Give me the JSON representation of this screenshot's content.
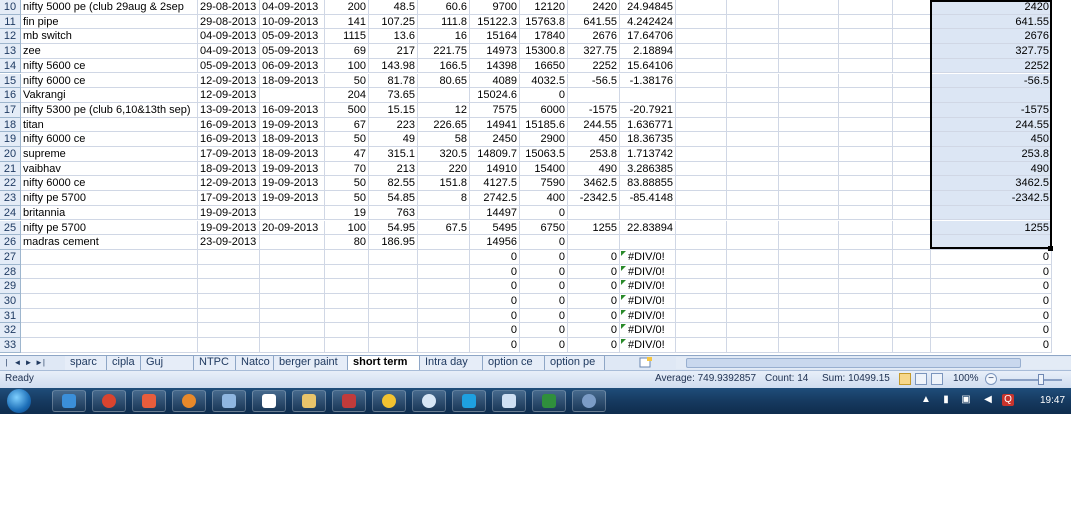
{
  "rows": [
    {
      "n": "10",
      "cells": [
        "nifty 5000 pe (club 29aug & 2sep",
        "29-08-2013",
        "04-09-2013",
        "200",
        "48.5",
        "60.6",
        "9700",
        "12120",
        "2420",
        "24.94845"
      ],
      "sel": "2420"
    },
    {
      "n": "11",
      "cells": [
        "fin pipe",
        "29-08-2013",
        "10-09-2013",
        "141",
        "107.25",
        "111.8",
        "15122.3",
        "15763.8",
        "641.55",
        "4.242424"
      ],
      "sel": "641.55"
    },
    {
      "n": "12",
      "cells": [
        "mb switch",
        "04-09-2013",
        "05-09-2013",
        "1115",
        "13.6",
        "16",
        "15164",
        "17840",
        "2676",
        "17.64706"
      ],
      "sel": "2676"
    },
    {
      "n": "13",
      "cells": [
        "zee",
        "04-09-2013",
        "05-09-2013",
        "69",
        "217",
        "221.75",
        "14973",
        "15300.8",
        "327.75",
        "2.18894"
      ],
      "sel": "327.75"
    },
    {
      "n": "14",
      "cells": [
        "nifty 5600 ce",
        "05-09-2013",
        "06-09-2013",
        "100",
        "143.98",
        "166.5",
        "14398",
        "16650",
        "2252",
        "15.64106"
      ],
      "sel": "2252"
    },
    {
      "n": "15",
      "cells": [
        "nifty 6000 ce",
        "12-09-2013",
        "18-09-2013",
        "50",
        "81.78",
        "80.65",
        "4089",
        "4032.5",
        "-56.5",
        "-1.38176"
      ],
      "sel": "-56.5"
    },
    {
      "n": "16",
      "cells": [
        "Vakrangi",
        "12-09-2013",
        "",
        "204",
        "73.65",
        "",
        "15024.6",
        "0",
        "",
        ""
      ],
      "sel": ""
    },
    {
      "n": "17",
      "cells": [
        "nifty 5300 pe (club 6,10&13th sep)",
        "13-09-2013",
        "16-09-2013",
        "500",
        "15.15",
        "12",
        "7575",
        "6000",
        "-1575",
        "-20.7921"
      ],
      "sel": "-1575"
    },
    {
      "n": "18",
      "cells": [
        "titan",
        "16-09-2013",
        "19-09-2013",
        "67",
        "223",
        "226.65",
        "14941",
        "15185.6",
        "244.55",
        "1.636771"
      ],
      "sel": "244.55"
    },
    {
      "n": "19",
      "cells": [
        "nifty 6000 ce",
        "16-09-2013",
        "18-09-2013",
        "50",
        "49",
        "58",
        "2450",
        "2900",
        "450",
        "18.36735"
      ],
      "sel": "450"
    },
    {
      "n": "20",
      "cells": [
        "supreme",
        "17-09-2013",
        "18-09-2013",
        "47",
        "315.1",
        "320.5",
        "14809.7",
        "15063.5",
        "253.8",
        "1.713742"
      ],
      "sel": "253.8"
    },
    {
      "n": "21",
      "cells": [
        "vaibhav",
        "18-09-2013",
        "19-09-2013",
        "70",
        "213",
        "220",
        "14910",
        "15400",
        "490",
        "3.286385"
      ],
      "sel": "490"
    },
    {
      "n": "22",
      "cells": [
        "nifty 6000 ce",
        "12-09-2013",
        "19-09-2013",
        "50",
        "82.55",
        "151.8",
        "4127.5",
        "7590",
        "3462.5",
        "83.88855"
      ],
      "sel": "3462.5"
    },
    {
      "n": "23",
      "cells": [
        "nifty pe 5700",
        "17-09-2013",
        "19-09-2013",
        "50",
        "54.85",
        "8",
        "2742.5",
        "400",
        "-2342.5",
        "-85.4148"
      ],
      "sel": "-2342.5"
    },
    {
      "n": "24",
      "cells": [
        "britannia",
        "19-09-2013",
        "",
        "19",
        "763",
        "",
        "14497",
        "0",
        "",
        ""
      ],
      "sel": ""
    },
    {
      "n": "25",
      "cells": [
        "nifty pe 5700",
        "19-09-2013",
        "20-09-2013",
        "100",
        "54.95",
        "67.5",
        "5495",
        "6750",
        "1255",
        "22.83894"
      ],
      "sel": "1255"
    },
    {
      "n": "26",
      "cells": [
        "madras cement",
        "23-09-2013",
        "",
        "80",
        "186.95",
        "",
        "14956",
        "0",
        "",
        ""
      ],
      "sel": ""
    },
    {
      "n": "27",
      "cells": [
        "",
        "",
        "",
        "",
        "",
        "",
        "0",
        "0",
        "0",
        "#DIV/0!"
      ],
      "sel": "0"
    },
    {
      "n": "28",
      "cells": [
        "",
        "",
        "",
        "",
        "",
        "",
        "0",
        "0",
        "0",
        "#DIV/0!"
      ],
      "sel": "0"
    },
    {
      "n": "29",
      "cells": [
        "",
        "",
        "",
        "",
        "",
        "",
        "0",
        "0",
        "0",
        "#DIV/0!"
      ],
      "sel": "0"
    },
    {
      "n": "30",
      "cells": [
        "",
        "",
        "",
        "",
        "",
        "",
        "0",
        "0",
        "0",
        "#DIV/0!"
      ],
      "sel": "0"
    },
    {
      "n": "31",
      "cells": [
        "",
        "",
        "",
        "",
        "",
        "",
        "0",
        "0",
        "0",
        "#DIV/0!"
      ],
      "sel": "0"
    },
    {
      "n": "32",
      "cells": [
        "",
        "",
        "",
        "",
        "",
        "",
        "0",
        "0",
        "0",
        "#DIV/0!"
      ],
      "sel": "0"
    },
    {
      "n": "33",
      "cells": [
        "",
        "",
        "",
        "",
        "",
        "",
        "0",
        "0",
        "0",
        "#DIV/0!"
      ],
      "sel": "0"
    }
  ],
  "tabs": [
    "sparc",
    "cipla",
    "Guj alkali",
    "NTPC",
    "Natco",
    "berger paint",
    "short term",
    "Intra day",
    "option ce",
    "option pe"
  ],
  "active_tab": "short term",
  "status": {
    "ready": "Ready",
    "average": "Average: 749.9392857",
    "count": "Count: 14",
    "sum": "Sum: 10499.15",
    "zoom": "100%"
  },
  "clock": "19:47",
  "colors": {
    "accent": "#1f3b63",
    "selection": "#dce6f4",
    "error_triangle": "#2a8a2a",
    "taskbar": "#163a60"
  }
}
